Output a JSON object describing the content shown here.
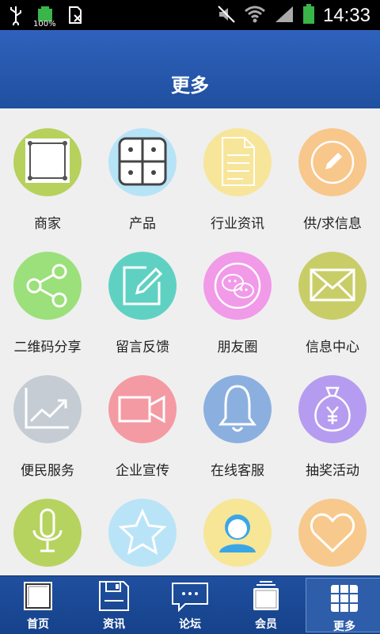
{
  "status_bar": {
    "time": "14:33",
    "battery_label": "100%"
  },
  "header": {
    "title": "更多"
  },
  "grid_items": [
    {
      "label": "商家",
      "color": "#b6d15c",
      "icon": "frame-icon"
    },
    {
      "label": "产品",
      "color": "#b7e3f7",
      "icon": "four-squares-icon"
    },
    {
      "label": "行业资讯",
      "color": "#f7e59a",
      "icon": "document-icon"
    },
    {
      "label": "供/求信息",
      "color": "#f8c78b",
      "icon": "pencil-circle-icon"
    },
    {
      "label": "二维码分享",
      "color": "#9be07a",
      "icon": "share-icon"
    },
    {
      "label": "留言反馈",
      "color": "#5fd1c3",
      "icon": "edit-note-icon"
    },
    {
      "label": "朋友圈",
      "color": "#f19ae8",
      "icon": "chat-bubbles-icon"
    },
    {
      "label": "信息中心",
      "color": "#c9cd68",
      "icon": "envelope-icon"
    },
    {
      "label": "便民服务",
      "color": "#c6ccd3",
      "icon": "trend-chart-icon"
    },
    {
      "label": "企业宣传",
      "color": "#f49aa3",
      "icon": "video-camera-icon"
    },
    {
      "label": "在线客服",
      "color": "#8bb0df",
      "icon": "bell-icon"
    },
    {
      "label": "抽奖活动",
      "color": "#b69cf0",
      "icon": "money-bag-icon"
    },
    {
      "label": "",
      "color": "#b7d35f",
      "icon": "microphone-icon"
    },
    {
      "label": "",
      "color": "#b9e4f8",
      "icon": "star-icon"
    },
    {
      "label": "",
      "color": "#f7e696",
      "icon": "user-icon"
    },
    {
      "label": "",
      "color": "#f8c98c",
      "icon": "heart-icon"
    }
  ],
  "bottom_tabs": [
    {
      "label": "首页",
      "icon": "home-icon",
      "active": false
    },
    {
      "label": "资讯",
      "icon": "save-icon",
      "active": false
    },
    {
      "label": "论坛",
      "icon": "chat-icon",
      "active": false
    },
    {
      "label": "会员",
      "icon": "member-card-icon",
      "active": false
    },
    {
      "label": "更多",
      "icon": "grid-icon",
      "active": true
    }
  ]
}
